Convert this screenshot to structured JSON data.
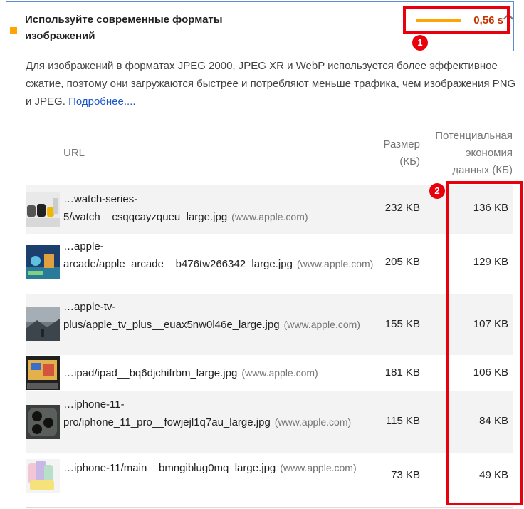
{
  "audit": {
    "title": "Используйте современные форматы изображений",
    "time_savings": "0,56 s",
    "description": "Для изображений в форматах JPEG 2000, JPEG XR и WebP используется более эффективное сжатие, поэтому они загружаются быстрее и потребляют меньше трафика, чем изображения PNG и JPEG.",
    "learn_more": "Подробнее...."
  },
  "annotations": [
    "1",
    "2"
  ],
  "table": {
    "headers": {
      "url": "URL",
      "size": "Размер (КБ)",
      "savings": "Потенциальная экономия данных (КБ)"
    },
    "rows": [
      {
        "url": "…watch-series-5/watch__csqqcayzqueu_large.jpg",
        "host": "(www.apple.com)",
        "size": "232 KB",
        "savings": "136 KB"
      },
      {
        "url": "…apple-arcade/apple_arcade__b476tw266342_large.jpg",
        "host": "(www.apple.com)",
        "size": "205 KB",
        "savings": "129 KB"
      },
      {
        "url": "…apple-tv-plus/apple_tv_plus__euax5nw0l46e_large.jpg",
        "host": "(www.apple.com)",
        "size": "155 KB",
        "savings": "107 KB"
      },
      {
        "url": "…ipad/ipad__bq6djchifrbm_large.jpg",
        "host": "(www.apple.com)",
        "size": "181 KB",
        "savings": "106 KB"
      },
      {
        "url": "…iphone-11-pro/iphone_11_pro__fowjejl1q7au_large.jpg",
        "host": "(www.apple.com)",
        "size": "115 KB",
        "savings": "84 KB"
      },
      {
        "url": "…iphone-11/main__bmngiblug0mq_large.jpg",
        "host": "(www.apple.com)",
        "size": "73 KB",
        "savings": "49 KB"
      }
    ]
  }
}
